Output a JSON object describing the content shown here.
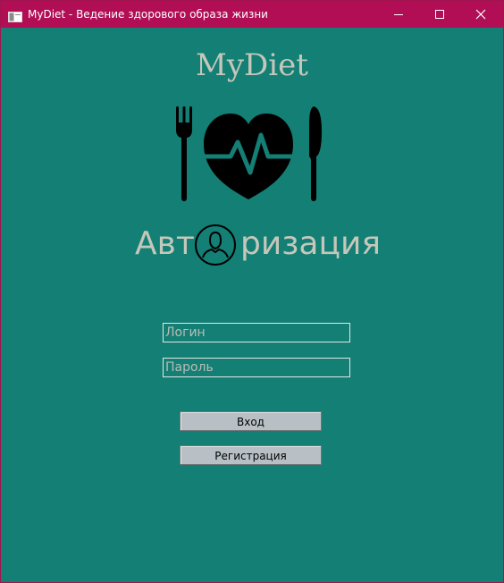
{
  "window": {
    "title": "MyDiet - Ведение здорового образа жизни"
  },
  "brand": {
    "name": "MyDiet",
    "logo_icon": "fork-heart-pulse-knife-icon"
  },
  "auth": {
    "title_part1": "Авт",
    "title_part2": "ризация",
    "title_icon": "user-circle-icon"
  },
  "form": {
    "login_placeholder": "Логин",
    "password_placeholder": "Пароль",
    "login_value": "",
    "password_value": ""
  },
  "buttons": {
    "login_label": "Вход",
    "register_label": "Регистрация"
  },
  "colors": {
    "titlebar": "#b10e55",
    "background": "#137f75",
    "text_light": "#c5c7ba",
    "button_bg": "#b9c0c5"
  }
}
